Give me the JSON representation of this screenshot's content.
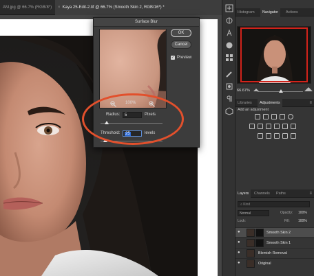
{
  "tabs": [
    {
      "label": "AM.jpg @ 66.7% (RGB/8*)",
      "close": "×",
      "active": false
    },
    {
      "label": "Kaya 25-Edit-2.tif @ 66.7% (Smooth Skin 2, RGB/16*) *",
      "close": "×",
      "active": true
    }
  ],
  "panels": {
    "top_tabs": [
      "Histogram",
      "Navigator",
      "Actions"
    ],
    "navigator": {
      "zoom": "66.67%"
    },
    "mid_tabs": [
      "Libraries",
      "Adjustments"
    ],
    "adjustments": {
      "hint": "Add an adjustment"
    },
    "layer_tabs": [
      "Layers",
      "Channels",
      "Paths"
    ],
    "layers": {
      "search_placeholder": "Kind",
      "blend_mode": "Normal",
      "opacity_label": "Opacity:",
      "opacity_value": "100%",
      "lock_label": "Lock:",
      "fill_label": "Fill:",
      "fill_value": "100%",
      "items": [
        {
          "name": "Smooth Skin 2",
          "selected": true,
          "has_mask": true
        },
        {
          "name": "Smooth Skin 1",
          "selected": false,
          "has_mask": true
        },
        {
          "name": "Blemish Removal",
          "selected": false,
          "has_mask": false
        },
        {
          "name": "Original",
          "selected": false,
          "has_mask": false
        }
      ]
    }
  },
  "dialog": {
    "title": "Surface Blur",
    "ok_label": "OK",
    "cancel_label": "Cancel",
    "preview_label": "Preview",
    "preview_checked": true,
    "zoom_label": "100%",
    "radius_label": "Radius:",
    "radius_value": "5",
    "radius_unit": "Pixels",
    "threshold_label": "Threshold:",
    "threshold_value": "25",
    "threshold_unit": "levels"
  },
  "colors": {
    "annotation": "#e2502c",
    "navigator_frame": "#d2231b",
    "highlight": "#2e6bd6"
  }
}
